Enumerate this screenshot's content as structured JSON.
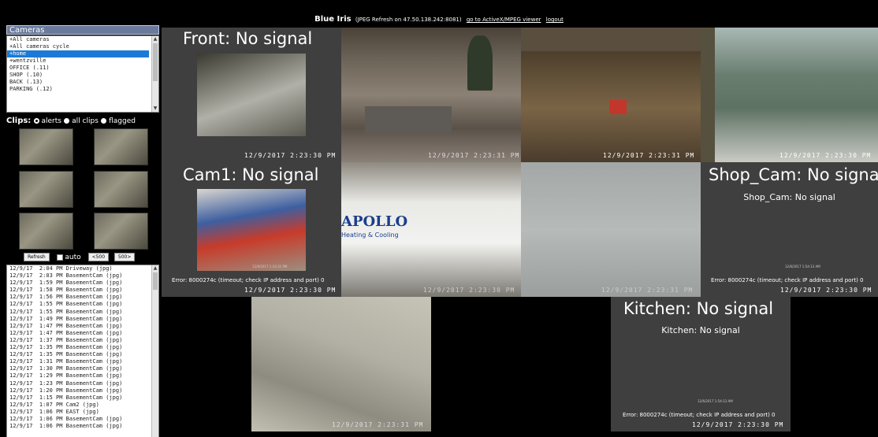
{
  "header": {
    "app_name": "Blue Iris",
    "refresh_info": "(JPEG Refresh on 47.50.138.242:8081)",
    "activex_link": "go to ActiveX/MPEG viewer",
    "logout_link": "logout"
  },
  "cameras_panel": {
    "title": "Cameras",
    "items": [
      "+All cameras",
      "+All cameras cycle",
      "+home",
      "+wentzville",
      "OFFICE (.11)",
      "SHOP (.10)",
      "BACK (.13)",
      "PARKING (.12)"
    ],
    "selected": "+home"
  },
  "clips_panel": {
    "title": "Clips:",
    "options": [
      "alerts",
      "all clips",
      "flagged"
    ],
    "selected": "alerts",
    "refresh_label": "Refresh",
    "auto_label": "auto",
    "prev_label": "<500",
    "next_label": "500>"
  },
  "clip_log": [
    "12/9/17  2:04 PM Driveway (jpg)",
    "12/9/17  2:03 PM BasementCam (jpg)",
    "12/9/17  1:59 PM BasementCam (jpg)",
    "12/9/17  1:58 PM BasementCam (jpg)",
    "12/9/17  1:56 PM BasementCam (jpg)",
    "12/9/17  1:55 PM BasementCam (jpg)",
    "12/9/17  1:55 PM BasementCam (jpg)",
    "12/9/17  1:49 PM BasementCam (jpg)",
    "12/9/17  1:47 PM BasementCam (jpg)",
    "12/9/17  1:47 PM BasementCam (jpg)",
    "12/9/17  1:37 PM BasementCam (jpg)",
    "12/9/17  1:35 PM BasementCam (jpg)",
    "12/9/17  1:35 PM BasementCam (jpg)",
    "12/9/17  1:31 PM BasementCam (jpg)",
    "12/9/17  1:30 PM BasementCam (jpg)",
    "12/9/17  1:29 PM BasementCam (jpg)",
    "12/9/17  1:23 PM BasementCam (jpg)",
    "12/9/17  1:20 PM BasementCam (jpg)",
    "12/9/17  1:15 PM BasementCam (jpg)",
    "12/9/17  1:07 PM Cam2 (jpg)",
    "12/9/17  1:06 PM EAST (jpg)",
    "12/9/17  1:06 PM BasementCam (jpg)",
    "12/9/17  1:06 PM BasementCam (jpg)"
  ],
  "feeds": {
    "front": {
      "title": "Front: No signal",
      "timestamp": "12/9/2017 2:23:30 PM"
    },
    "living": {
      "timestamp": "12/9/2017 2:23:31 PM"
    },
    "den": {
      "timestamp": "12/9/2017 2:23:31 PM"
    },
    "pool": {
      "timestamp": "12/9/2017 2:23:30 PM"
    },
    "cam1": {
      "title": "Cam1: No signal",
      "small_ts": "12/9/2017 1:16:31 PM",
      "error": "Error: 8000274c (timeout; check IP address and port) 0",
      "timestamp": "12/9/2017 2:23:30 PM"
    },
    "van": {
      "timestamp": "12/9/2017 2:23:30 PM",
      "brand": "APOLLO",
      "brand_sub": "Heating & Cooling"
    },
    "yard": {
      "timestamp": "12/9/2017 2:23:31 PM"
    },
    "shop": {
      "title": "Shop_Cam: No signal",
      "subtitle": "Shop_Cam: No signal",
      "small_ts": "12/6/2017 1:54:13 AM",
      "error": "Error: 8000274c (timeout; check IP address and port) 0",
      "timestamp": "12/9/2017 2:23:30 PM"
    },
    "floor": {
      "timestamp": "12/9/2017 2:23:31 PM"
    },
    "kitchen": {
      "title": "Kitchen: No signal",
      "subtitle": "Kitchen: No signal",
      "small_ts": "12/6/2017 1:54:13 AM",
      "error": "Error: 8000274c (timeout; check IP address and port) 0",
      "timestamp": "12/9/2017 2:23:30 PM"
    }
  }
}
